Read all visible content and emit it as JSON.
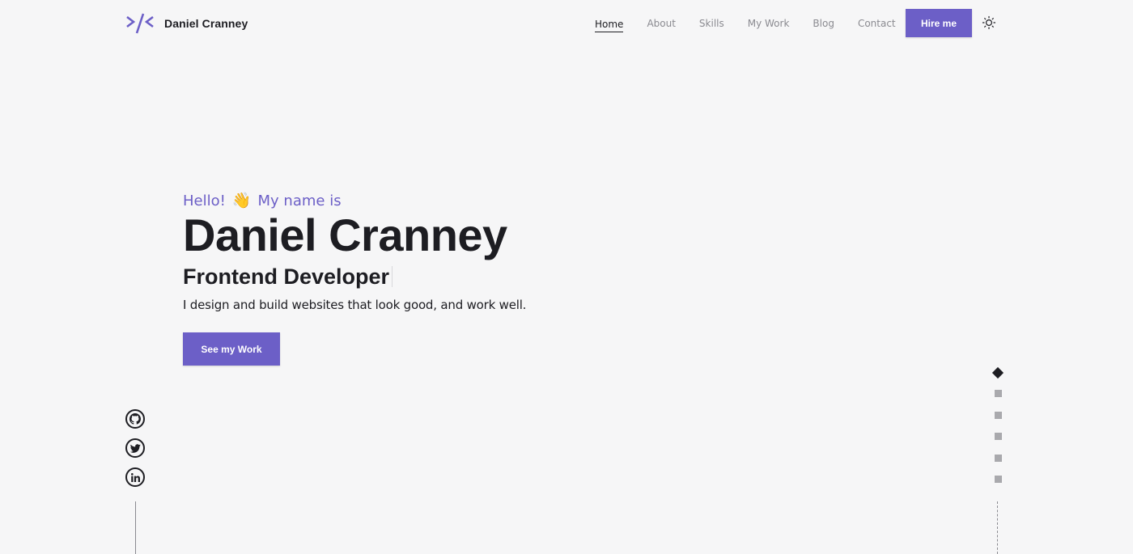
{
  "header": {
    "brand_name": "Daniel Cranney",
    "nav": [
      {
        "label": "Home",
        "active": true
      },
      {
        "label": "About",
        "active": false
      },
      {
        "label": "Skills",
        "active": false
      },
      {
        "label": "My Work",
        "active": false
      },
      {
        "label": "Blog",
        "active": false
      },
      {
        "label": "Contact",
        "active": false
      }
    ],
    "hire_label": "Hire me",
    "theme_icon": "sun-icon"
  },
  "hero": {
    "greeting_hello": "Hello!",
    "greeting_icon": "waving-hand-icon",
    "greeting_rest": "My name is",
    "name": "Daniel Cranney",
    "role": "Frontend Developer",
    "description": "I design and build websites that look good, and work well.",
    "cta_label": "See my Work"
  },
  "social": [
    "github-icon",
    "twitter-icon",
    "linkedin-icon"
  ],
  "section_indicators": {
    "count": 6,
    "active_index": 0
  },
  "colors": {
    "accent": "#6c5fc7",
    "text": "#1d1d22",
    "background": "#f6f6f7",
    "muted": "#8a8a90"
  }
}
